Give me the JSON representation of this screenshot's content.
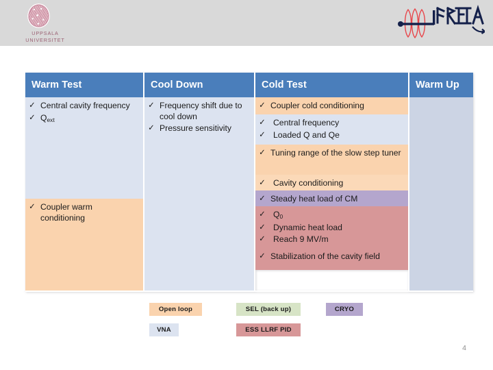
{
  "header": {
    "university_logo": {
      "name": "uppsala-university-logo",
      "line1": "UPPSALA",
      "line2": "UNIVERSITET"
    },
    "project_logo": {
      "name": "freia-logo",
      "text": "FREIA"
    }
  },
  "table": {
    "columns": [
      {
        "key": "warm_test",
        "label": "Warm Test"
      },
      {
        "key": "cool_down",
        "label": "Cool Down"
      },
      {
        "key": "cold_test",
        "label": "Cold Test"
      },
      {
        "key": "warm_up",
        "label": "Warm Up"
      }
    ],
    "check_glyph": "✓",
    "warm_test": [
      {
        "fill": "fill-blue",
        "items": [
          "Central cavity frequency",
          "Qext"
        ]
      },
      {
        "fill": "fill-peach",
        "items": [
          "Coupler warm conditioning"
        ]
      }
    ],
    "cool_down": [
      {
        "fill": "fill-blue",
        "items": [
          "Frequency shift due to cool down",
          "Pressure sensitivity"
        ]
      }
    ],
    "cold_test": [
      {
        "fill": "fill-peach",
        "items": [
          "Coupler cold conditioning"
        ]
      },
      {
        "fill": "fill-blue",
        "items": [
          "Central frequency",
          "Loaded Q and Qe"
        ]
      },
      {
        "fill": "fill-peach",
        "items": [
          "Tuning range of the slow step tuner"
        ]
      },
      {
        "fill": "fill-peach2",
        "items": [
          "Cavity conditioning"
        ]
      },
      {
        "fill": "fill-purple",
        "items": [
          "Steady heat load of CM"
        ]
      },
      {
        "fill": "fill-rose",
        "items": [
          "Q0",
          "Dynamic heat load",
          "Reach 9 MV/m"
        ]
      },
      {
        "fill": "fill-rose",
        "items": [
          "Stabilization of the cavity field"
        ]
      }
    ],
    "warm_up": [
      {
        "fill": "fill-grayblue",
        "items": []
      }
    ]
  },
  "legend": {
    "open_loop": "Open loop",
    "vna": "VNA",
    "sel": "SEL (back up)",
    "ess": "ESS LLRF PID",
    "cryo": "CRYO"
  },
  "footer": {
    "page_number": "4"
  },
  "colors": {
    "header_blue": "#4a7ebb",
    "header_band": "#d9d9d9",
    "fill_blue": "#dce3f0",
    "fill_peach": "#fad3ae",
    "fill_purple": "#b4a6cd",
    "fill_rose": "#d79798",
    "fill_green": "#d7e4c6",
    "fill_grayblue": "#ccd4e4",
    "page_number": "#8c8c8c"
  }
}
